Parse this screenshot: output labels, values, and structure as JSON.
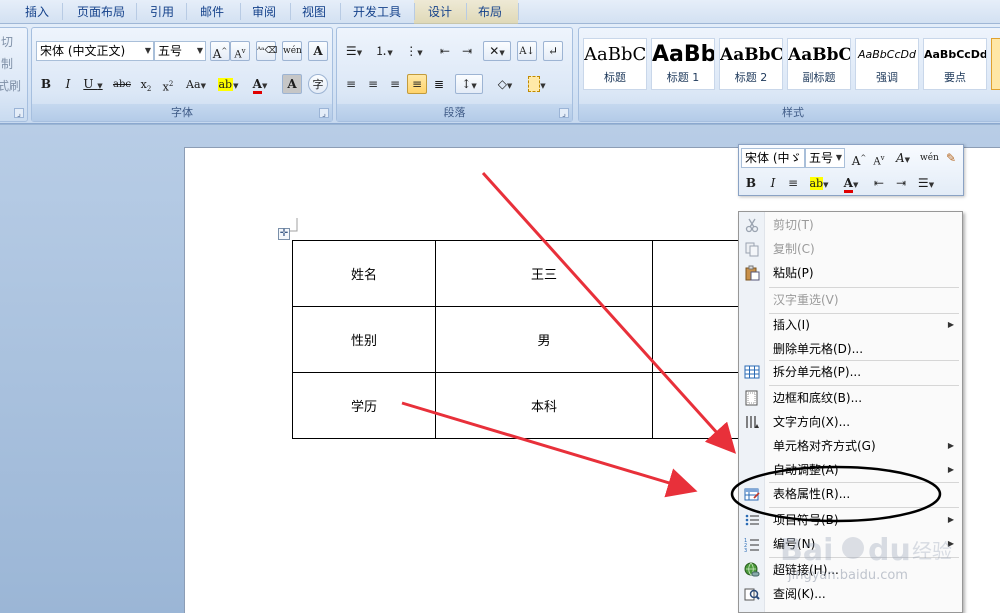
{
  "ribbon": {
    "tabs": [
      "插入",
      "页面布局",
      "引用",
      "邮件",
      "审阅",
      "视图",
      "开发工具",
      "设计",
      "布局"
    ],
    "clipboard_partial": [
      "切",
      "制",
      "式刷"
    ],
    "font_group": {
      "label": "字体",
      "font_name": "宋体 (中文正文)",
      "font_size": "五号"
    },
    "paragraph_group": {
      "label": "段落"
    },
    "styles_group": {
      "label": "样式",
      "styles": [
        {
          "sample": "AaBbC",
          "name": "标题"
        },
        {
          "sample": "AaBb",
          "name": "标题 1"
        },
        {
          "sample": "AaBbC",
          "name": "标题 2"
        },
        {
          "sample": "AaBbC",
          "name": "副标题"
        },
        {
          "sample": "AaBbCcDd",
          "name": "强调"
        },
        {
          "sample": "AaBbCcDd",
          "name": "要点"
        }
      ]
    }
  },
  "document": {
    "table": [
      [
        "姓名",
        "王三",
        ""
      ],
      [
        "性别",
        "男",
        ""
      ],
      [
        "学历",
        "本科",
        ""
      ]
    ]
  },
  "mini_toolbar": {
    "font_name": "宋体 (中ゞ",
    "font_size": "五号"
  },
  "context_menu": {
    "items": [
      {
        "label": "剪切(T)",
        "disabled": true,
        "icon": "scissors-icon"
      },
      {
        "label": "复制(C)",
        "disabled": true,
        "icon": "copy-icon"
      },
      {
        "label": "粘贴(P)",
        "disabled": false,
        "icon": "paste-icon"
      },
      {
        "label": "汉字重选(V)",
        "disabled": true,
        "icon": ""
      },
      {
        "label": "插入(I)",
        "disabled": false,
        "icon": "",
        "submenu": true
      },
      {
        "label": "删除单元格(D)...",
        "disabled": false,
        "icon": ""
      },
      {
        "label": "拆分单元格(P)...",
        "disabled": false,
        "icon": "split-cells-icon"
      },
      {
        "label": "边框和底纹(B)...",
        "disabled": false,
        "icon": "borders-icon"
      },
      {
        "label": "文字方向(X)...",
        "disabled": false,
        "icon": "text-direction-icon"
      },
      {
        "label": "单元格对齐方式(G)",
        "disabled": false,
        "icon": "",
        "submenu": true
      },
      {
        "label": "自动调整(A)",
        "disabled": false,
        "icon": "",
        "submenu": true
      },
      {
        "label": "表格属性(R)...",
        "disabled": false,
        "icon": "table-properties-icon"
      },
      {
        "label": "项目符号(B)",
        "disabled": false,
        "icon": "bullets-icon",
        "submenu": true
      },
      {
        "label": "编号(N)",
        "disabled": false,
        "icon": "numbering-icon",
        "submenu": true
      },
      {
        "label": "超链接(H)...",
        "disabled": false,
        "icon": "hyperlink-icon"
      },
      {
        "label": "查阅(K)...",
        "disabled": false,
        "icon": "lookup-icon"
      }
    ]
  },
  "watermark": {
    "url": "jingyan.baidu.com"
  },
  "colors": {
    "annotation": "#e8303a",
    "accent": "#15428b"
  }
}
